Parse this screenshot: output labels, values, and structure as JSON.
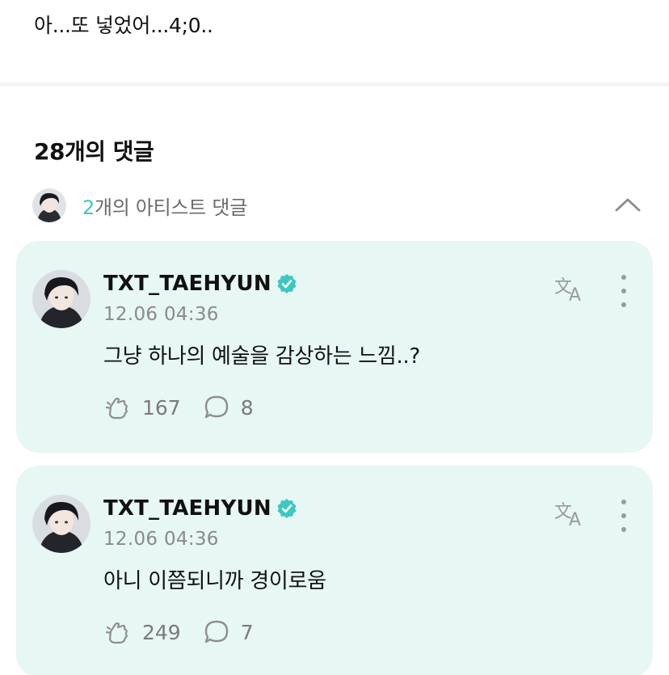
{
  "post": {
    "text": "아...또 넣었어...4;0.."
  },
  "comments_section": {
    "count_label": "28개의 댓글",
    "artist_summary": {
      "count": "2",
      "suffix": "개의 아티스트 댓글",
      "expanded": true
    }
  },
  "colors": {
    "accent": "#3cc7c0",
    "card_bg": "#e7f7f4",
    "icon_gray": "#9a9a9a"
  },
  "comments": [
    {
      "username": "TXT_TAEHYUN",
      "verified": true,
      "timestamp": "12.06 04:36",
      "text": "그냥 하나의 예술을 감상하는 느낌..?",
      "likes": "167",
      "replies": "8"
    },
    {
      "username": "TXT_TAEHYUN",
      "verified": true,
      "timestamp": "12.06 04:36",
      "text": "아니 이쯤되니까 경이로움",
      "likes": "249",
      "replies": "7"
    }
  ],
  "icons": [
    "chevron-up-icon",
    "verified-icon",
    "translate-icon",
    "more-vertical-icon",
    "cheer-hand-icon",
    "comment-bubble-icon"
  ]
}
